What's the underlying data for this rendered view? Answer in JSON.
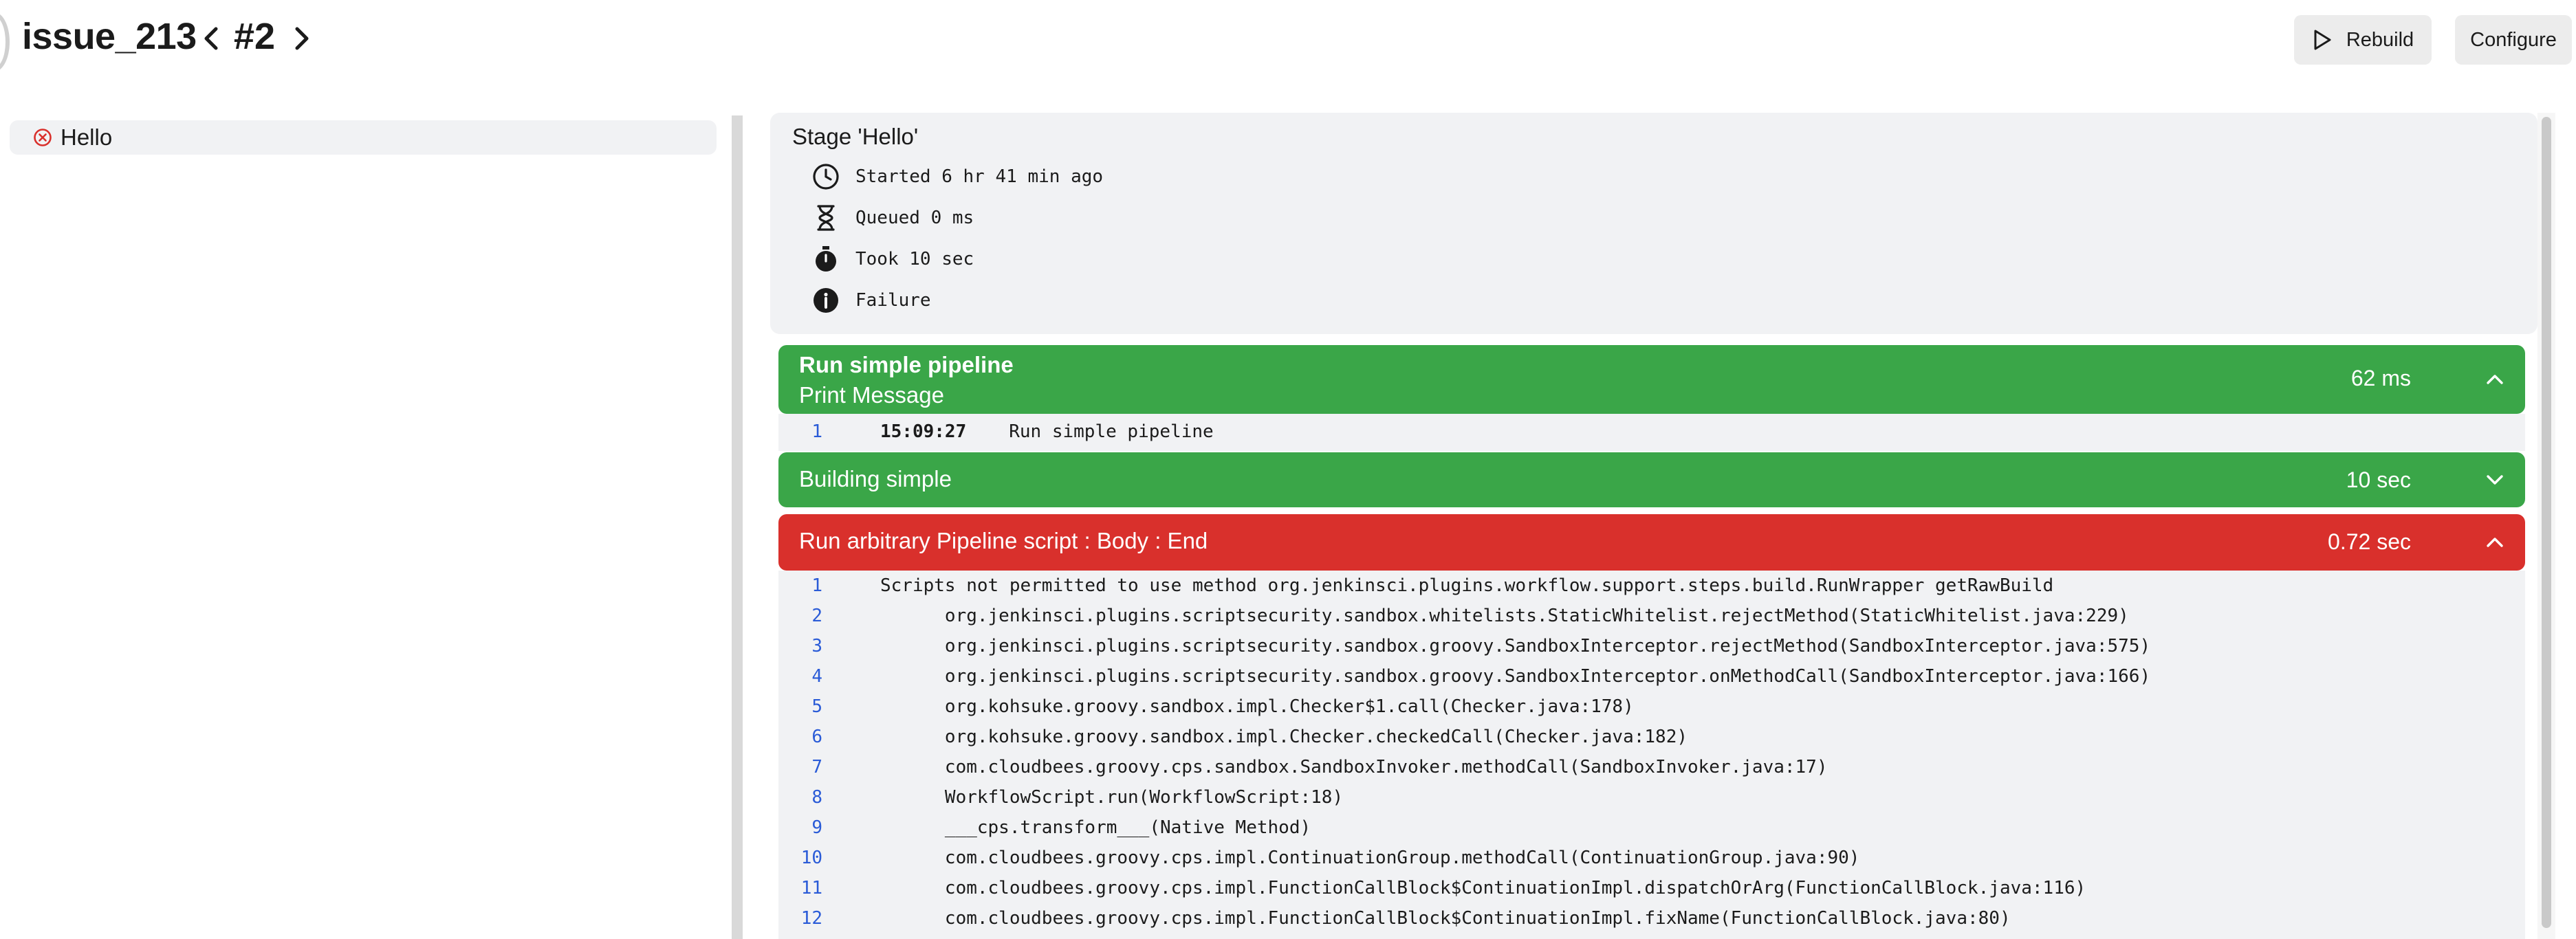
{
  "header": {
    "job_name": "issue_213",
    "build_number": "#2",
    "prev_label": "‹",
    "next_label": "›",
    "rebuild_label": "Rebuild",
    "configure_label": "Configure"
  },
  "sidebar": {
    "stages": [
      {
        "label": "Hello",
        "status": "failed"
      }
    ]
  },
  "stage_detail": {
    "title": "Stage 'Hello'",
    "meta": {
      "started": "Started 6 hr 41 min ago",
      "queued": "Queued 0 ms",
      "took": "Took 10 sec",
      "result": "Failure"
    }
  },
  "steps": [
    {
      "title": "Run simple pipeline",
      "subtitle": "Print Message",
      "duration": "62 ms",
      "status": "success",
      "expanded": true,
      "log": [
        {
          "n": "1",
          "time": "15:09:27",
          "text": "Run simple pipeline"
        }
      ]
    },
    {
      "title": "Building simple",
      "duration": "10 sec",
      "status": "success",
      "expanded": false
    },
    {
      "title": "Run arbitrary Pipeline script : Body : End",
      "duration": "0.72 sec",
      "status": "failed",
      "expanded": true,
      "log": [
        {
          "n": "1",
          "text": "Scripts not permitted to use method org.jenkinsci.plugins.workflow.support.steps.build.RunWrapper getRawBuild"
        },
        {
          "n": "2",
          "text": "      org.jenkinsci.plugins.scriptsecurity.sandbox.whitelists.StaticWhitelist.rejectMethod(StaticWhitelist.java:229)"
        },
        {
          "n": "3",
          "text": "      org.jenkinsci.plugins.scriptsecurity.sandbox.groovy.SandboxInterceptor.rejectMethod(SandboxInterceptor.java:575)"
        },
        {
          "n": "4",
          "text": "      org.jenkinsci.plugins.scriptsecurity.sandbox.groovy.SandboxInterceptor.onMethodCall(SandboxInterceptor.java:166)"
        },
        {
          "n": "5",
          "text": "      org.kohsuke.groovy.sandbox.impl.Checker$1.call(Checker.java:178)"
        },
        {
          "n": "6",
          "text": "      org.kohsuke.groovy.sandbox.impl.Checker.checkedCall(Checker.java:182)"
        },
        {
          "n": "7",
          "text": "      com.cloudbees.groovy.cps.sandbox.SandboxInvoker.methodCall(SandboxInvoker.java:17)"
        },
        {
          "n": "8",
          "text": "      WorkflowScript.run(WorkflowScript:18)"
        },
        {
          "n": "9",
          "text": "      ___cps.transform___(Native Method)"
        },
        {
          "n": "10",
          "text": "      com.cloudbees.groovy.cps.impl.ContinuationGroup.methodCall(ContinuationGroup.java:90)"
        },
        {
          "n": "11",
          "text": "      com.cloudbees.groovy.cps.impl.FunctionCallBlock$ContinuationImpl.dispatchOrArg(FunctionCallBlock.java:116)"
        },
        {
          "n": "12",
          "text": "      com.cloudbees.groovy.cps.impl.FunctionCallBlock$ContinuationImpl.fixName(FunctionCallBlock.java:80)"
        }
      ]
    }
  ],
  "colors": {
    "success": "#3aa648",
    "failed": "#d9302c",
    "panel_bg": "#f1f2f4",
    "line_number": "#2a5bd7"
  },
  "icons": {
    "rebuild": "play-icon",
    "status_failed": "x-circle-icon",
    "started": "clock-icon",
    "queued": "hourglass-icon",
    "took": "stopwatch-icon",
    "result": "info-icon"
  }
}
